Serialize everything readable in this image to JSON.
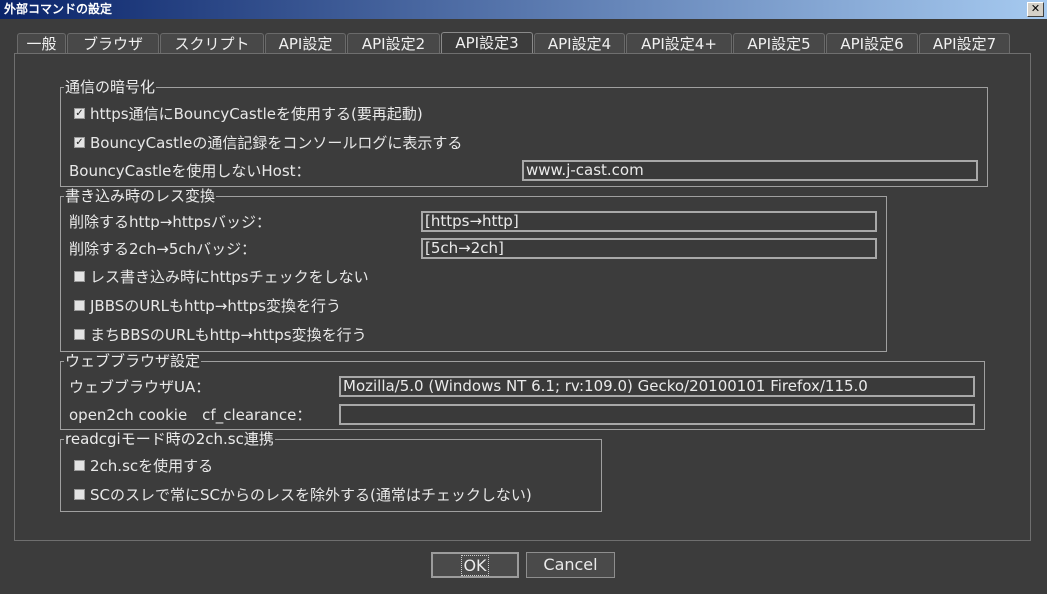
{
  "window": {
    "title": "外部コマンドの設定",
    "close_symbol": "✕"
  },
  "tabs": [
    {
      "label": "一般",
      "active": false
    },
    {
      "label": "ブラウザ",
      "active": false
    },
    {
      "label": "スクリプト",
      "active": false
    },
    {
      "label": "API設定",
      "active": false
    },
    {
      "label": "API設定2",
      "active": false
    },
    {
      "label": "API設定3",
      "active": true
    },
    {
      "label": "API設定4",
      "active": false
    },
    {
      "label": "API設定4+",
      "active": false
    },
    {
      "label": "API設定5",
      "active": false
    },
    {
      "label": "API設定6",
      "active": false
    },
    {
      "label": "API設定7",
      "active": false
    }
  ],
  "encryption": {
    "legend": "通信の暗号化",
    "https_bc_label": "https通信にBouncyCastleを使用する(要再起動)",
    "https_bc_checked": true,
    "bc_log_label": "BouncyCastleの通信記録をコンソールログに表示する",
    "bc_log_checked": true,
    "host_label": "BouncyCastleを使用しないHost：",
    "host_value": "www.j-cast.com"
  },
  "res_conversion": {
    "legend": "書き込み時のレス変換",
    "http_badge_label": "削除するhttp→httpsバッジ：",
    "http_badge_value": "[https→http]",
    "ch_badge_label": "削除する2ch→5chバッジ：",
    "ch_badge_value": "[5ch→2ch]",
    "no_https_check_label": "レス書き込み時にhttpsチェックをしない",
    "no_https_check_checked": false,
    "jbbs_label": "JBBSのURLもhttp→https変換を行う",
    "jbbs_checked": false,
    "machi_label": "まちBBSのURLもhttp→https変換を行う",
    "machi_checked": false
  },
  "web_browser": {
    "legend": "ウェブブラウザ設定",
    "ua_label": "ウェブブラウザUA：",
    "ua_value": "Mozilla/5.0 (Windows NT 6.1; rv:109.0) Gecko/20100101 Firefox/115.0",
    "cookie_label": "open2ch cookie　cf_clearance：",
    "cookie_value": ""
  },
  "readcgi": {
    "legend": "readcgiモード時の2ch.sc連携",
    "use_sc_label": "2ch.scを使用する",
    "use_sc_checked": false,
    "exclude_sc_label": "SCのスレで常にSCからのレスを除外する(通常はチェックしない)",
    "exclude_sc_checked": false
  },
  "buttons": {
    "ok": "OK",
    "cancel": "Cancel"
  },
  "check_mark": "✓"
}
